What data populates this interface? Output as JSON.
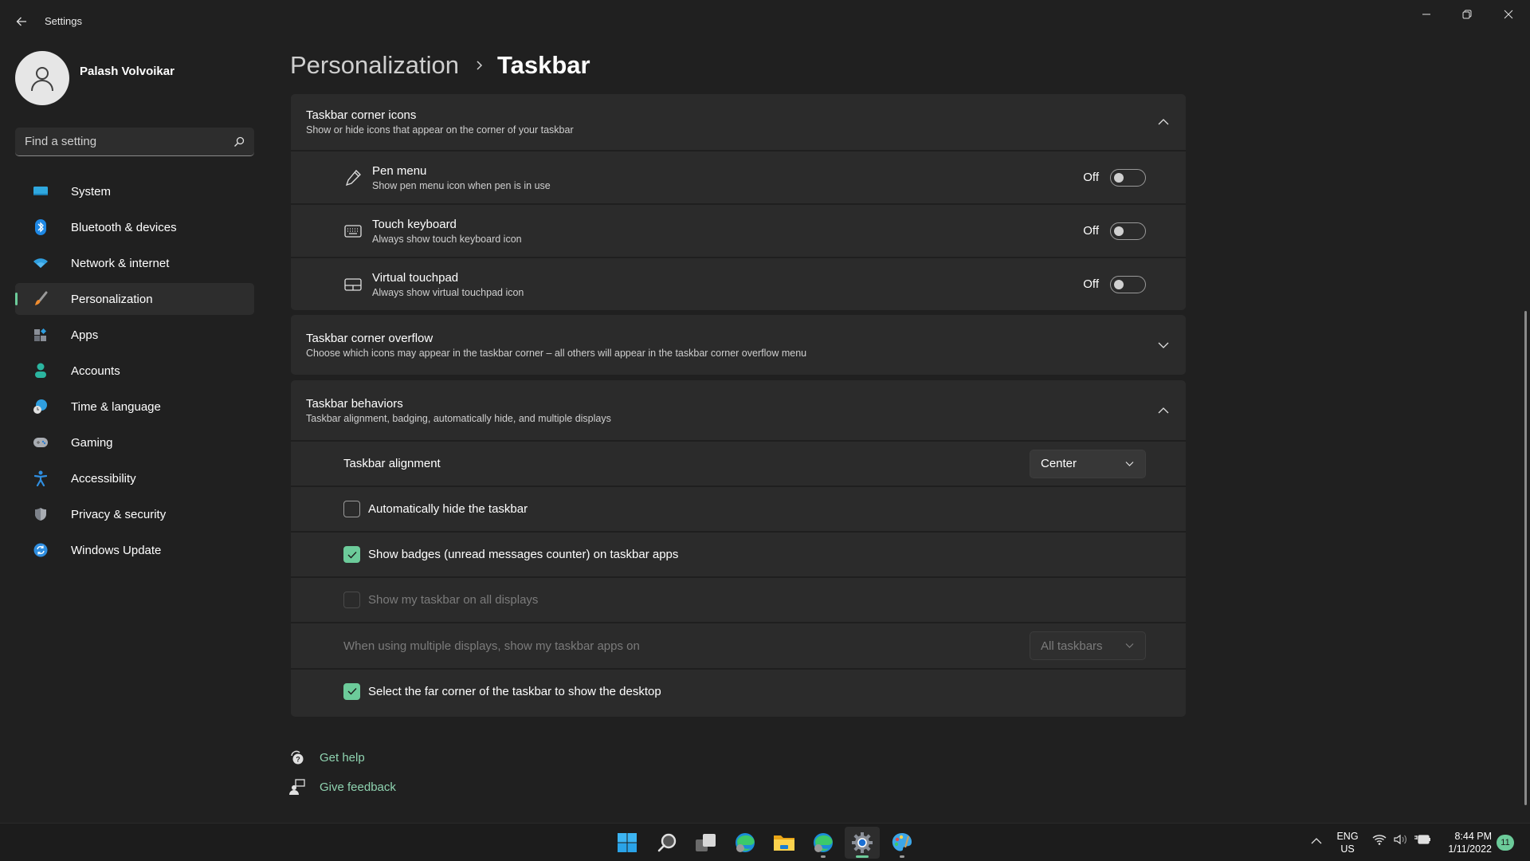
{
  "window": {
    "title": "Settings",
    "controls": {
      "minimize": "minimize",
      "maximize": "restore",
      "close": "close"
    }
  },
  "profile": {
    "name": "Palash Volvoikar",
    "avatar_icon": "person-icon"
  },
  "search": {
    "placeholder": "Find a setting",
    "value": "",
    "icon": "search-icon"
  },
  "sidebar": {
    "active_index": 3,
    "accent": "#6ccb9a",
    "items": [
      {
        "label": "System",
        "icon": "monitor-icon"
      },
      {
        "label": "Bluetooth & devices",
        "icon": "bluetooth-icon"
      },
      {
        "label": "Network & internet",
        "icon": "wifi-icon"
      },
      {
        "label": "Personalization",
        "icon": "paintbrush-icon"
      },
      {
        "label": "Apps",
        "icon": "apps-icon"
      },
      {
        "label": "Accounts",
        "icon": "person-icon"
      },
      {
        "label": "Time & language",
        "icon": "globe-clock-icon"
      },
      {
        "label": "Gaming",
        "icon": "gamepad-icon"
      },
      {
        "label": "Accessibility",
        "icon": "accessibility-icon"
      },
      {
        "label": "Privacy & security",
        "icon": "shield-icon"
      },
      {
        "label": "Windows Update",
        "icon": "refresh-icon"
      }
    ]
  },
  "breadcrumb": {
    "parent": "Personalization",
    "separator": "›",
    "current": "Taskbar"
  },
  "sections": {
    "corner_icons": {
      "title": "Taskbar corner icons",
      "subtitle": "Show or hide icons that appear on the corner of your taskbar",
      "expanded": true,
      "items": [
        {
          "title": "Pen menu",
          "subtitle": "Show pen menu icon when pen is in use",
          "icon": "pen-icon",
          "state_label": "Off",
          "on": false
        },
        {
          "title": "Touch keyboard",
          "subtitle": "Always show touch keyboard icon",
          "icon": "keyboard-icon",
          "state_label": "Off",
          "on": false
        },
        {
          "title": "Virtual touchpad",
          "subtitle": "Always show virtual touchpad icon",
          "icon": "touchpad-icon",
          "state_label": "Off",
          "on": false
        }
      ]
    },
    "corner_overflow": {
      "title": "Taskbar corner overflow",
      "subtitle": "Choose which icons may appear in the taskbar corner – all others will appear in the taskbar corner overflow menu",
      "expanded": false
    },
    "behaviors": {
      "title": "Taskbar behaviors",
      "subtitle": "Taskbar alignment, badging, automatically hide, and multiple displays",
      "expanded": true,
      "alignment": {
        "label": "Taskbar alignment",
        "value": "Center"
      },
      "auto_hide": {
        "label": "Automatically hide the taskbar",
        "checked": false
      },
      "badges": {
        "label": "Show badges (unread messages counter) on taskbar apps",
        "checked": true
      },
      "all_displays": {
        "label": "Show my taskbar on all displays",
        "checked": false,
        "disabled": true
      },
      "multi_display": {
        "label": "When using multiple displays, show my taskbar apps on",
        "value": "All taskbars",
        "disabled": true
      },
      "far_corner": {
        "label": "Select the far corner of the taskbar to show the desktop",
        "checked": true
      }
    }
  },
  "help": {
    "get_help": "Get help",
    "give_feedback": "Give feedback"
  },
  "taskbar": {
    "apps": [
      {
        "name": "Start",
        "icon": "windows-start-icon",
        "state": "none"
      },
      {
        "name": "Search",
        "icon": "search-icon",
        "state": "none"
      },
      {
        "name": "Task View",
        "icon": "task-view-icon",
        "state": "none"
      },
      {
        "name": "Microsoft Edge",
        "icon": "edge-icon",
        "state": "none"
      },
      {
        "name": "File Explorer",
        "icon": "folder-icon",
        "state": "none"
      },
      {
        "name": "Microsoft Edge",
        "icon": "edge-icon",
        "state": "running"
      },
      {
        "name": "Settings",
        "icon": "gear-icon",
        "state": "active"
      },
      {
        "name": "Paint",
        "icon": "palette-icon",
        "state": "running"
      }
    ],
    "tray": {
      "language_line1": "ENG",
      "language_line2": "US",
      "time": "8:44 PM",
      "date": "1/11/2022",
      "notification_count": "11"
    }
  }
}
